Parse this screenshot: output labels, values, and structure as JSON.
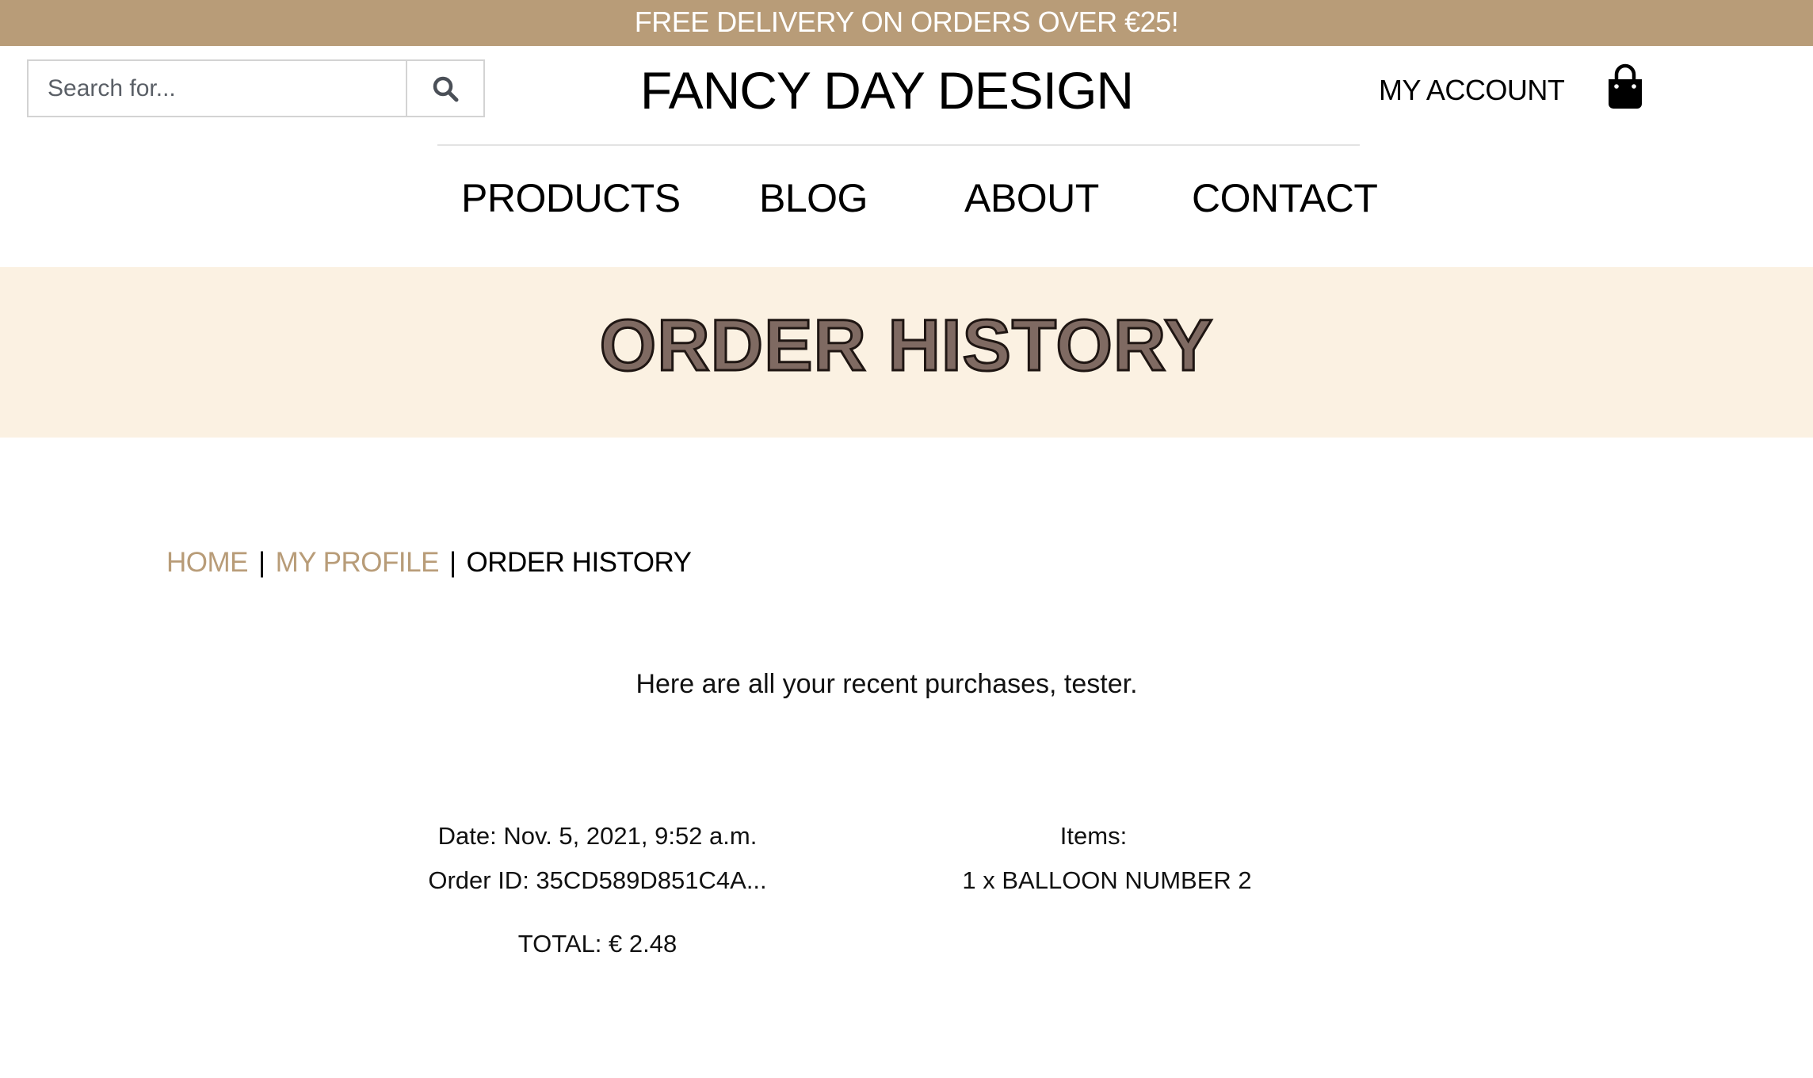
{
  "promo": {
    "text": "FREE DELIVERY ON ORDERS OVER €25!"
  },
  "header": {
    "search": {
      "placeholder": "Search for...",
      "icon": "search-icon"
    },
    "brand": "FANCY DAY DESIGN",
    "account_label": "MY ACCOUNT",
    "bag_icon": "shopping-bag-icon"
  },
  "nav": {
    "items": [
      {
        "label": "PRODUCTS"
      },
      {
        "label": "BLOG"
      },
      {
        "label": "ABOUT"
      },
      {
        "label": "CONTACT"
      }
    ]
  },
  "hero": {
    "title": "ORDER HISTORY"
  },
  "breadcrumb": {
    "home": "HOME",
    "profile": "MY PROFILE",
    "current": "ORDER HISTORY",
    "separator": "|"
  },
  "intro": "Here are all your recent purchases, tester.",
  "orders": [
    {
      "date": "Date: Nov. 5, 2021, 9:52 a.m.",
      "order_id": "Order ID: 35CD589D851C4A...",
      "total": "TOTAL: € 2.48",
      "items_label": "Items:",
      "items": [
        "1 x BALLOON NUMBER 2"
      ]
    }
  ],
  "colors": {
    "accent": "#b89c78",
    "hero_background": "#fbf1e2",
    "hero_title_fill": "#7f6a62"
  }
}
